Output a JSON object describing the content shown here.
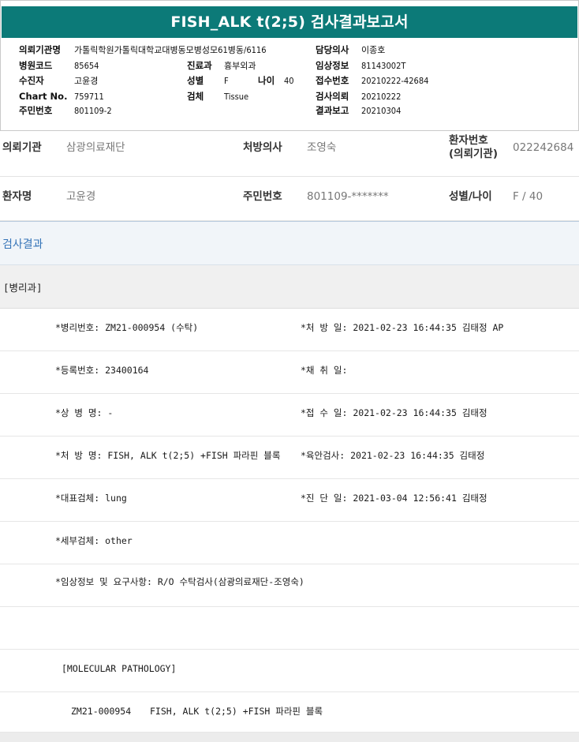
{
  "report": {
    "title": "FISH_ALK t(2;5) 검사결과보고서",
    "fields": [
      {
        "label": "의뢰기관명",
        "value": "가톨릭학원가톨릭대학교대병동모병성모61병동/6116"
      },
      {
        "label": "병원코드",
        "value": "85654"
      },
      {
        "label": "수진자",
        "value": "고윤경"
      },
      {
        "label": "Chart No.",
        "value": "759711"
      },
      {
        "label": "주민번호",
        "value": "801109-2"
      },
      {
        "label": "진료과",
        "value": "흉부외과"
      },
      {
        "label": "성별",
        "value": "F"
      },
      {
        "label": "나이",
        "value": "40"
      },
      {
        "label": "검체",
        "value": "Tissue"
      },
      {
        "label": "담당의사",
        "value": "이종호"
      },
      {
        "label": "임상정보",
        "value": "81143002T"
      },
      {
        "label": "접수번호",
        "value": "20210222-42684"
      },
      {
        "label": "검사의뢰",
        "value": "20210222"
      },
      {
        "label": "결과보고",
        "value": "20210304"
      }
    ]
  },
  "info": {
    "institution_label": "의뢰기관",
    "institution_value": "삼광의료재단",
    "doctor_label": "처방의사",
    "doctor_value": "조영숙",
    "patient_no_label_1": "환자번호",
    "patient_no_label_2": "(의뢰기관)",
    "patient_no_value": "022242684",
    "name_label": "환자명",
    "name_value": "고윤경",
    "resident_label": "주민번호",
    "resident_value": "801109-*******",
    "sex_age_label": "성별/나이",
    "sex_age_value": "F / 40"
  },
  "results": {
    "section_title": "검사결과",
    "department": "[병리과]",
    "lines": [
      {
        "left": "*병리번호: ZM21-000954 (수탁)",
        "right": "*처 방 일: 2021-02-23 16:44:35  김태정 AP"
      },
      {
        "left": "*등록번호: 23400164",
        "right": "*채 취 일:"
      },
      {
        "left": "*상 병 명: -",
        "right": "*접 수 일: 2021-02-23 16:44:35  김태정"
      },
      {
        "left": "*처 방 명: FISH, ALK t(2;5) +FISH 파라핀 블록",
        "right": "*육안검사: 2021-02-23 16:44:35  김태정"
      },
      {
        "left": "*대표검체: lung",
        "right": "*진 단 일: 2021-03-04 12:56:41  김태정"
      },
      {
        "left": "*세부검체: other",
        "right": ""
      },
      {
        "left": "*임상정보 및 요구사항: R/O 수탁검사(삼광의료재단-조영숙)",
        "right": ""
      }
    ],
    "molecular_header": "[MOLECULAR PATHOLOGY]",
    "molecular_line_no": "ZM21-000954",
    "molecular_line_text": "FISH, ALK t(2;5) +FISH 파라핀 블록"
  }
}
